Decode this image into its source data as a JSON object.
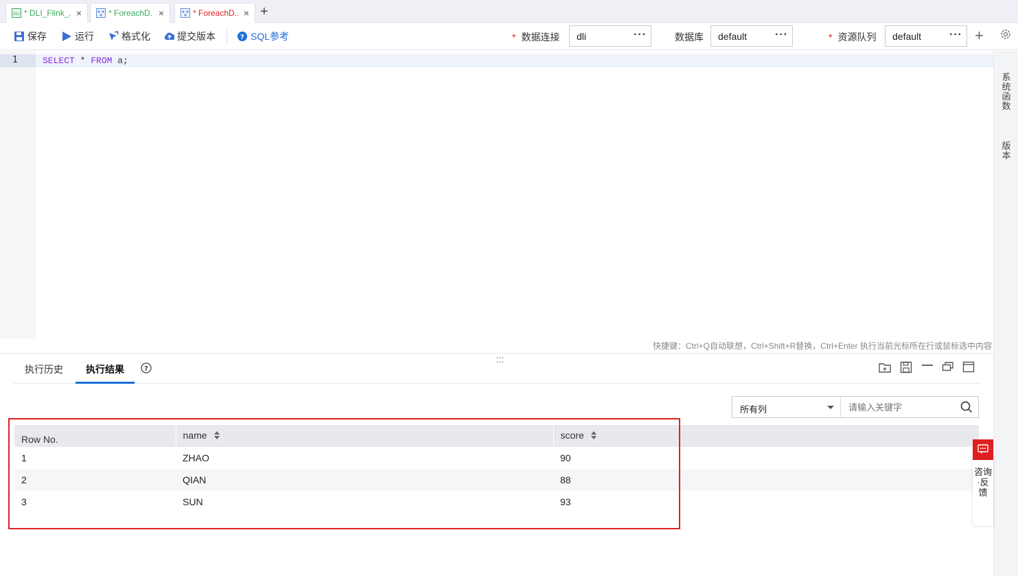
{
  "tabs": [
    {
      "label": "* DLI_Flink_...",
      "icon": "dli-icon",
      "color": "#3aaa5b"
    },
    {
      "label": "* ForeachD...",
      "icon": "flow-icon",
      "color": "#3aaa5b"
    },
    {
      "label": "* ForeachD...",
      "icon": "flow-icon",
      "color": "#e02020"
    }
  ],
  "toolbar": {
    "save_label": "保存",
    "run_label": "运行",
    "format_label": "格式化",
    "submit_label": "提交版本",
    "sqlref_label": "SQL参考",
    "conn_label": "数据连接",
    "conn_value": "dli",
    "db_label": "数据库",
    "db_value": "default",
    "queue_label": "资源队列",
    "queue_value": "default",
    "required_mark": "*",
    "more_dots": "···"
  },
  "editor": {
    "line_number": "1",
    "code_kw1": "SELECT",
    "code_mid": " * ",
    "code_kw2": "FROM",
    "code_rest": " a;",
    "shortcut_hint": "快捷键：Ctrl+Q自动联想，Ctrl+Shift+R替换，Ctrl+Enter 执行当前光标所在行或鼠标选中内容"
  },
  "rail": {
    "functions": "系统函数",
    "version": "版本"
  },
  "panel": {
    "tab_history": "执行历史",
    "tab_results": "执行结果",
    "filter_select": "所有列",
    "filter_placeholder": "请输入关键字"
  },
  "table": {
    "headers": [
      "Row No.",
      "name",
      "score"
    ],
    "rows": [
      [
        "1",
        "ZHAO",
        "90"
      ],
      [
        "2",
        "QIAN",
        "88"
      ],
      [
        "3",
        "SUN",
        "93"
      ]
    ]
  },
  "feedback": {
    "label": "咨询·反馈"
  },
  "colors": {
    "accent": "#1e6fd9",
    "highlight": "#e02020",
    "keyword": "#8a2be2"
  }
}
